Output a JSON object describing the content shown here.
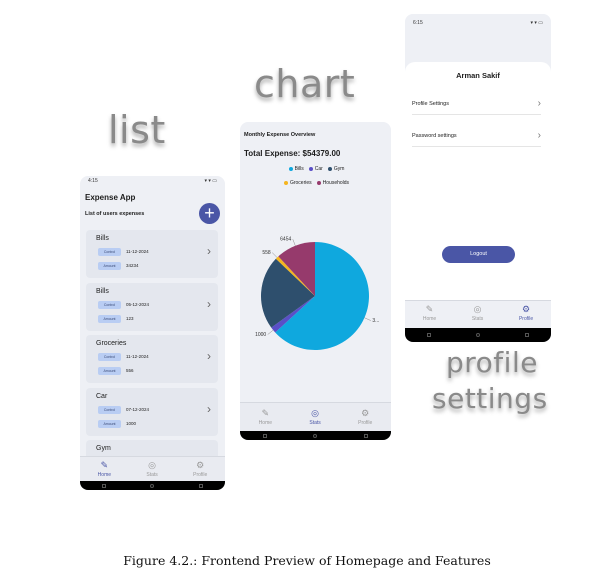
{
  "labels": {
    "list": "list",
    "chart": "chart",
    "profile": "profile",
    "settings": "settings"
  },
  "list_screen": {
    "status_time": "4:15",
    "status_icons": "▾ ▾ ▭",
    "app_title": "Expense App",
    "subtitle": "List of users expenses",
    "add_button": "+",
    "expenses": [
      {
        "category": "Bills",
        "control_label": "Control",
        "date": "11-12-2024",
        "amount_label": "Amount",
        "amount": "34234"
      },
      {
        "category": "Bills",
        "control_label": "Control",
        "date": "05-12-2024",
        "amount_label": "Amount",
        "amount": "123"
      },
      {
        "category": "Groceries",
        "control_label": "Control",
        "date": "11-12-2024",
        "amount_label": "Amount",
        "amount": "556"
      },
      {
        "category": "Car",
        "control_label": "Control",
        "date": "07-12-2024",
        "amount_label": "Amount",
        "amount": "1000"
      },
      {
        "category": "Gym",
        "control_label": "",
        "date": "",
        "amount_label": "",
        "amount": ""
      }
    ],
    "nav": {
      "home": "Home",
      "stats": "Stats",
      "profile": "Profile"
    }
  },
  "chart_screen": {
    "title": "Monthly Expense Overview",
    "total": "Total Expense: $54379.00",
    "nav": {
      "home": "Home",
      "stats": "Stats",
      "profile": "Profile"
    }
  },
  "chart_data": {
    "type": "pie",
    "title": "Monthly Expense Overview",
    "legend_placement": "top",
    "slices": [
      {
        "name": "Bills",
        "value": 34357,
        "color": "#0fa8de",
        "label": "3..."
      },
      {
        "name": "Car",
        "value": 1000,
        "color": "#5a4fc7",
        "label": "1000"
      },
      {
        "name": "Gym",
        "value": 12000,
        "color": "#2e4f6d",
        "label": ""
      },
      {
        "name": "Groceries",
        "value": 558,
        "color": "#f5b51f",
        "label": "558"
      },
      {
        "name": "Households",
        "value": 6454,
        "color": "#963a6c",
        "label": "6454"
      }
    ]
  },
  "profile_screen": {
    "status_time": "6:15",
    "user_name": "Arman Sakif",
    "profile_settings": "Profile Settings",
    "password_settings": "Password settings",
    "chevron": "›",
    "logout": "Logout",
    "nav": {
      "home": "Home",
      "stats": "Stats",
      "profile": "Profile"
    }
  },
  "caption": "Figure 4.2.: Frontend Preview of Homepage and Features"
}
